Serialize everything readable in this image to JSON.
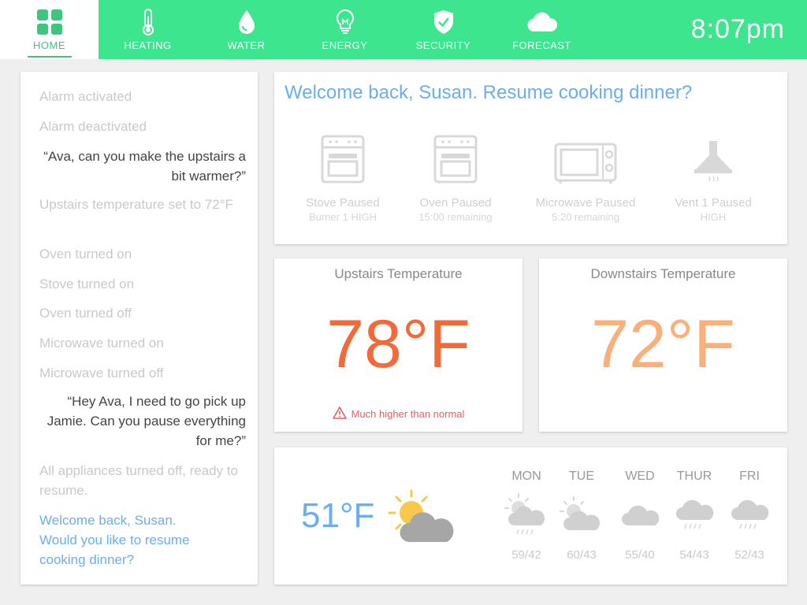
{
  "nav": {
    "items": [
      {
        "label": "HOME",
        "icon": "grid-icon"
      },
      {
        "label": "HEATING",
        "icon": "thermometer-icon"
      },
      {
        "label": "WATER",
        "icon": "water-drop-icon"
      },
      {
        "label": "ENERGY",
        "icon": "lightbulb-icon"
      },
      {
        "label": "SECURITY",
        "icon": "shield-check-icon"
      },
      {
        "label": "FORECAST",
        "icon": "cloud-icon"
      }
    ],
    "active": "HOME",
    "clock": "8:07pm"
  },
  "colors": {
    "accent": "#3ee58f",
    "blue": "#6aaef0",
    "hot": "#f26a3a",
    "warm": "#fbb07a",
    "warning": "#ee5c5c"
  },
  "log": {
    "entries": [
      {
        "text": "Alarm activated",
        "kind": "faded"
      },
      {
        "text": "Alarm deactivated",
        "kind": "faded"
      },
      {
        "text": "“Ava, can you make the upstairs a bit warmer?”",
        "kind": "speech"
      },
      {
        "text": "Upstairs temperature set to 72°F",
        "kind": "faded"
      },
      {
        "text": "Oven turned on",
        "kind": "faded"
      },
      {
        "text": "Stove turned on",
        "kind": "faded"
      },
      {
        "text": "Oven turned off",
        "kind": "faded"
      },
      {
        "text": "Microwave turned on",
        "kind": "faded"
      },
      {
        "text": "Microwave turned off",
        "kind": "faded"
      },
      {
        "text": "“Hey Ava, I need to go pick up Jamie. Can you pause everything for me?”",
        "kind": "speech"
      },
      {
        "text": "All appliances turned off, ready to resume.",
        "kind": "faded"
      },
      {
        "text": "Welcome back,  Susan. Would you like to resume cooking dinner?",
        "kind": "highlight"
      }
    ]
  },
  "welcome": {
    "title": "Welcome back, Susan. Resume cooking dinner?",
    "appliances": [
      {
        "name": "Stove Paused",
        "detail": "Burner 1 HIGH",
        "icon": "stove-icon"
      },
      {
        "name": "Oven Paused",
        "detail": "15:00 remaining",
        "icon": "oven-icon"
      },
      {
        "name": "Microwave Paused",
        "detail": "5:20 remaining",
        "icon": "microwave-icon"
      },
      {
        "name": "Vent 1 Paused",
        "detail": "HIGH",
        "icon": "vent-hood-icon"
      }
    ]
  },
  "temps": {
    "upstairs": {
      "title": "Upstairs Temperature",
      "value": "78°F",
      "warning": "Much higher than normal"
    },
    "downstairs": {
      "title": "Downstairs Temperature",
      "value": "72°F"
    }
  },
  "weather": {
    "current": {
      "temp": "51°F",
      "icon": "partly-cloudy-icon"
    },
    "forecast": [
      {
        "day": "MON",
        "range": "59/42",
        "icon": "sun-cloud-rain-icon"
      },
      {
        "day": "TUE",
        "range": "60/43",
        "icon": "sun-cloud-icon"
      },
      {
        "day": "WED",
        "range": "55/40",
        "icon": "cloud-icon"
      },
      {
        "day": "THUR",
        "range": "54/43",
        "icon": "cloud-rain-icon"
      },
      {
        "day": "FRI",
        "range": "52/43",
        "icon": "cloud-rain-icon"
      }
    ]
  }
}
